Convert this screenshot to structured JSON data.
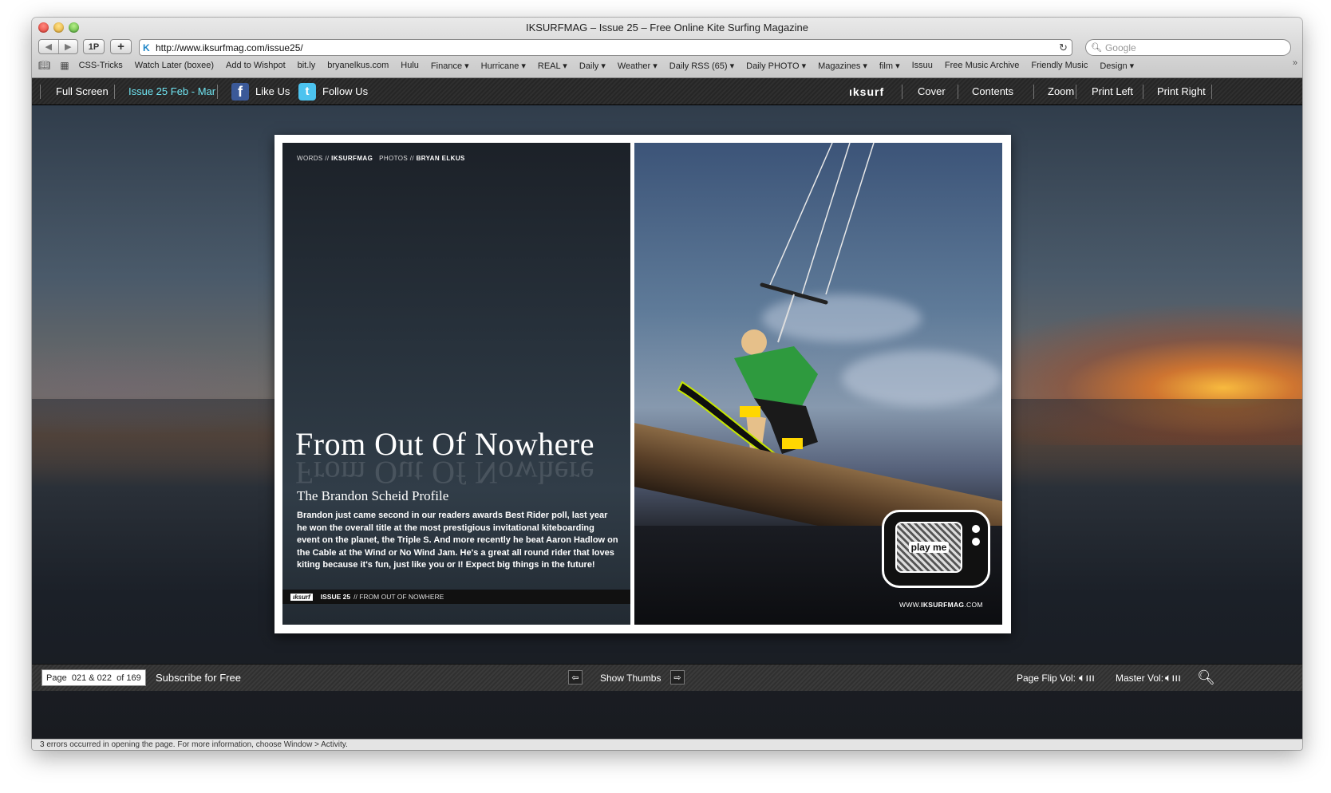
{
  "window": {
    "title": "IKSURFMAG – Issue 25 – Free Online Kite Surfing Magazine"
  },
  "toolbar": {
    "back_icon": "back-arrow-icon",
    "forward_icon": "forward-arrow-icon",
    "onepassword_label": "1P",
    "add_label": "+",
    "url": "http://www.iksurfmag.com/issue25/",
    "search_placeholder": "Google"
  },
  "bookmarks": [
    "CSS-Tricks",
    "Watch Later (boxee)",
    "Add to Wishpot",
    "bit.ly",
    "bryanelkus.com",
    "Hulu",
    "Finance ▾",
    "Hurricane ▾",
    "REAL ▾",
    "Daily ▾",
    "Weather ▾",
    "Daily RSS (65) ▾",
    "Daily PHOTO ▾",
    "Magazines ▾",
    "film ▾",
    "Issuu",
    "Free Music Archive",
    "Friendly Music",
    "Design ▾"
  ],
  "topnav": {
    "full_screen": "Full Screen",
    "issue": "Issue 25 Feb - Mar",
    "like": "Like Us",
    "follow": "Follow Us",
    "logo": "ıksurf",
    "cover": "Cover",
    "contents": "Contents",
    "zoom": "Zoom",
    "print_left": "Print Left",
    "print_right": "Print Right"
  },
  "article": {
    "credits_words": "WORDS //",
    "credits_words_name": "IKSURFMAG",
    "credits_photos": "PHOTOS //",
    "credits_photos_name": "BRYAN ELKUS",
    "headline": "From Out Of Nowhere",
    "subhead": "The Brandon Scheid Profile",
    "body": "Brandon just came second in our readers awards Best Rider poll, last year he won the overall title at the most prestigious invitational kiteboarding event on the planet, the Triple S. And more recently he beat Aaron Hadlow on the Cable at the Wind or No Wind Jam. He's a great all round rider that loves kiting because it's fun, just like you or I! Expect big things in the future!",
    "footer_logo": "ıksurf",
    "footer_issue": "ISSUE 25",
    "footer_section": "// FROM OUT OF NOWHERE",
    "tv_label": "play me",
    "site_prefix": "WWW.",
    "site_name": "IKSURFMAG",
    "site_suffix": ".COM"
  },
  "bottombar": {
    "page_prefix": "Page",
    "page_numbers": "021 & 022",
    "page_of": "of 169",
    "subscribe": "Subscribe for Free",
    "show_thumbs": "Show Thumbs",
    "page_flip_vol": "Page Flip Vol:",
    "master_vol": "Master Vol:"
  },
  "status": "3 errors occurred in opening the page. For more information, choose Window > Activity.",
  "colors": {
    "accent_teal": "#6fe3f0",
    "facebook": "#3b5998",
    "twitter": "#4cc3ef"
  }
}
